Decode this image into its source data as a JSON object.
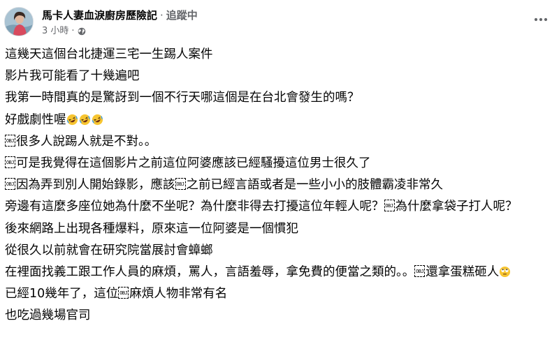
{
  "post": {
    "author_name": "馬卡人妻血淚廚房歷險記",
    "separator": "·",
    "follow_label": "追蹤中",
    "time": "3 小時",
    "meta_separator": "·",
    "privacy_icon": "globe-icon",
    "more_icon": "more-horizontal-icon",
    "obj_label": "OBJ",
    "lines": [
      [
        {
          "t": "text",
          "v": "這幾天這個台北捷運三宅一生踢人案件"
        }
      ],
      [
        {
          "t": "text",
          "v": "影片我可能看了十幾遍吧"
        }
      ],
      [
        {
          "t": "text",
          "v": "我第一時間真的是驚訝到一個不行天哪這個是在台北會發生的嗎？"
        }
      ],
      [
        {
          "t": "text",
          "v": "好戲劇性喔"
        },
        {
          "t": "emoji",
          "v": "rolling-laughing-emoji"
        },
        {
          "t": "emoji",
          "v": "rolling-laughing-emoji"
        },
        {
          "t": "emoji",
          "v": "rolling-laughing-emoji"
        }
      ],
      [
        {
          "t": "obj"
        },
        {
          "t": "text",
          "v": "很多人說踢人就是不對。。"
        }
      ],
      [
        {
          "t": "obj"
        },
        {
          "t": "text",
          "v": "可是我覺得在這個影片之前這位阿婆應該已經騷擾這位男士很久了"
        }
      ],
      [
        {
          "t": "obj"
        },
        {
          "t": "text",
          "v": "因為弄到別人開始錄影，應該"
        },
        {
          "t": "obj"
        },
        {
          "t": "text",
          "v": "之前已經言語或者是一些小小的肢體霸凌非常久"
        }
      ],
      [
        {
          "t": "text",
          "v": "旁邊有這麼多座位她為什麼不坐呢？為什麼非得去打擾這位年輕人呢？"
        },
        {
          "t": "obj"
        },
        {
          "t": "text",
          "v": "為什麼拿袋子打人呢？"
        }
      ],
      [
        {
          "t": "text",
          "v": "後來網路上出現各種爆料，原來這一位阿婆是一個慣犯"
        }
      ],
      [
        {
          "t": "text",
          "v": "從很久以前就會在研究院當展討會蟑螂"
        }
      ],
      [
        {
          "t": "text",
          "v": "在裡面找義工跟工作人員的麻煩，罵人，言語羞辱，拿免費的便當之類的。。"
        },
        {
          "t": "obj"
        },
        {
          "t": "text",
          "v": "還拿蛋糕砸人"
        },
        {
          "t": "emoji",
          "v": "rolling-eyes-emoji"
        }
      ],
      [
        {
          "t": "text",
          "v": "已經10幾年了，這位"
        },
        {
          "t": "obj"
        },
        {
          "t": "text",
          "v": "麻煩人物非常有名"
        }
      ],
      [
        {
          "t": "text",
          "v": "也吃過幾場官司"
        }
      ]
    ]
  }
}
